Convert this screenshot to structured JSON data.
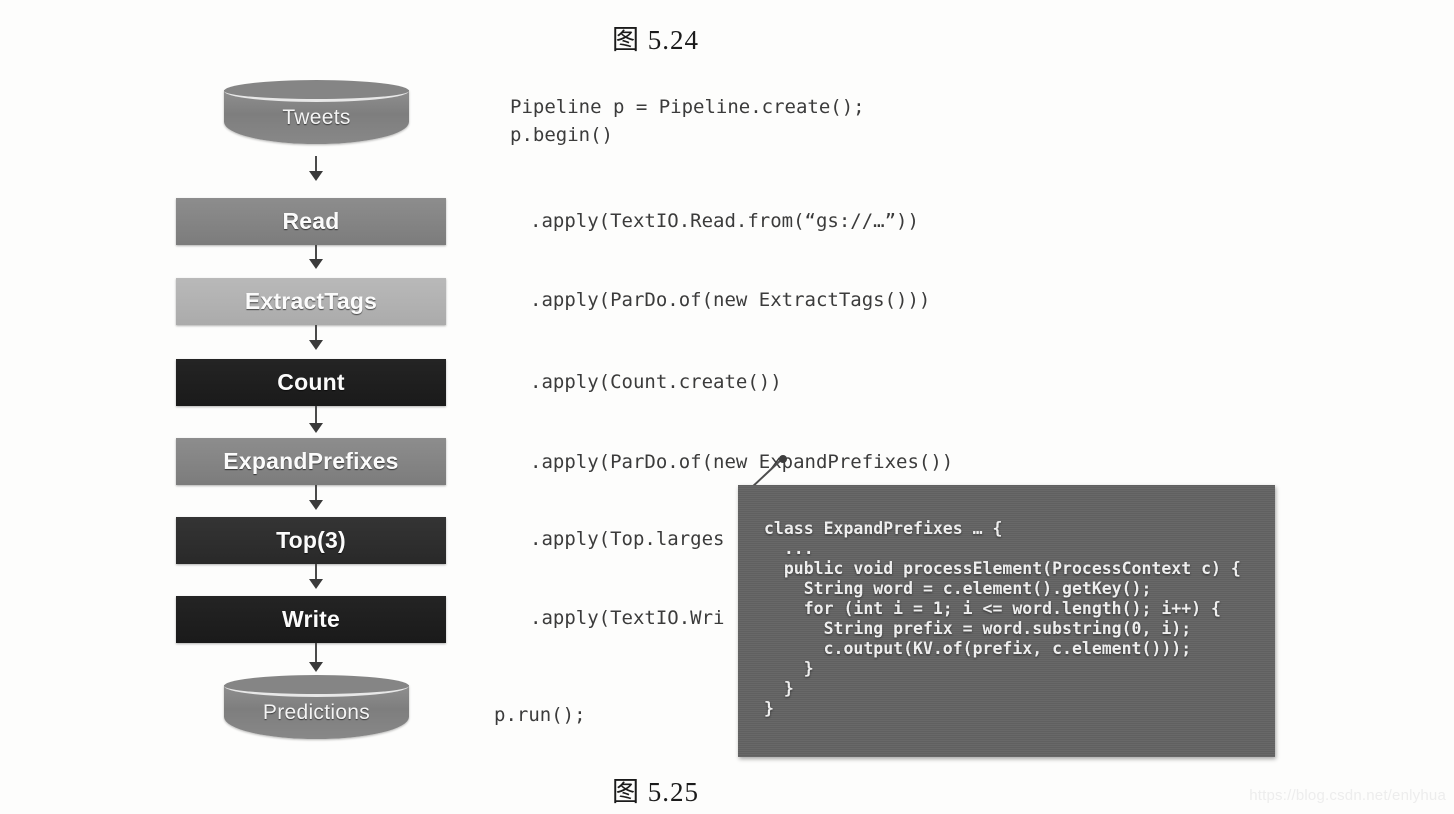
{
  "captions": {
    "top": "图 5.24",
    "bottom": "图 5.25"
  },
  "flowchart": {
    "nodes": [
      {
        "id": "tweets",
        "label": "Tweets",
        "shape": "cylinder",
        "tone": "mid",
        "color": "#858585"
      },
      {
        "id": "read",
        "label": "Read",
        "shape": "box",
        "tone": "mid",
        "color": "#8d8d8d"
      },
      {
        "id": "extract-tags",
        "label": "ExtractTags",
        "shape": "box",
        "tone": "light",
        "color": "#b9b9b9"
      },
      {
        "id": "count",
        "label": "Count",
        "shape": "box",
        "tone": "dark",
        "color": "#242424"
      },
      {
        "id": "expand-prefixes",
        "label": "ExpandPrefixes",
        "shape": "box",
        "tone": "mid",
        "color": "#8d8d8d"
      },
      {
        "id": "top3",
        "label": "Top(3)",
        "shape": "box",
        "tone": "darkmid",
        "color": "#343434"
      },
      {
        "id": "write",
        "label": "Write",
        "shape": "box",
        "tone": "dark",
        "color": "#242424"
      },
      {
        "id": "predictions",
        "label": "Predictions",
        "shape": "cylinder",
        "tone": "mid",
        "color": "#858585"
      }
    ]
  },
  "code_listing": {
    "lines": [
      {
        "id": "pipeline-create",
        "text": "Pipeline p = Pipeline.create();"
      },
      {
        "id": "pipeline-begin",
        "text": "p.begin()"
      },
      {
        "id": "apply-read",
        "text": ".apply(TextIO.Read.from(“gs://…”))"
      },
      {
        "id": "apply-extract",
        "text": ".apply(ParDo.of(new ExtractTags()))"
      },
      {
        "id": "apply-count",
        "text": ".apply(Count.create())"
      },
      {
        "id": "apply-expand",
        "text": ".apply(ParDo.of(new ExpandPrefixes())"
      },
      {
        "id": "apply-top",
        "text": ".apply(Top.larges"
      },
      {
        "id": "apply-write",
        "text": ".apply(TextIO.Wri"
      },
      {
        "id": "pipeline-run",
        "text": "p.run();"
      }
    ]
  },
  "code_overlay": {
    "body": "class ExpandPrefixes … {\n  ...\n  public void processElement(ProcessContext c) {\n    String word = c.element().getKey();\n    for (int i = 1; i <= word.length(); i++) {\n      String prefix = word.substring(0, i);\n      c.output(KV.of(prefix, c.element()));\n    }\n  }\n}",
    "background": "#636363"
  },
  "watermark": {
    "text": "https://blog.csdn.net/enlyhua"
  }
}
